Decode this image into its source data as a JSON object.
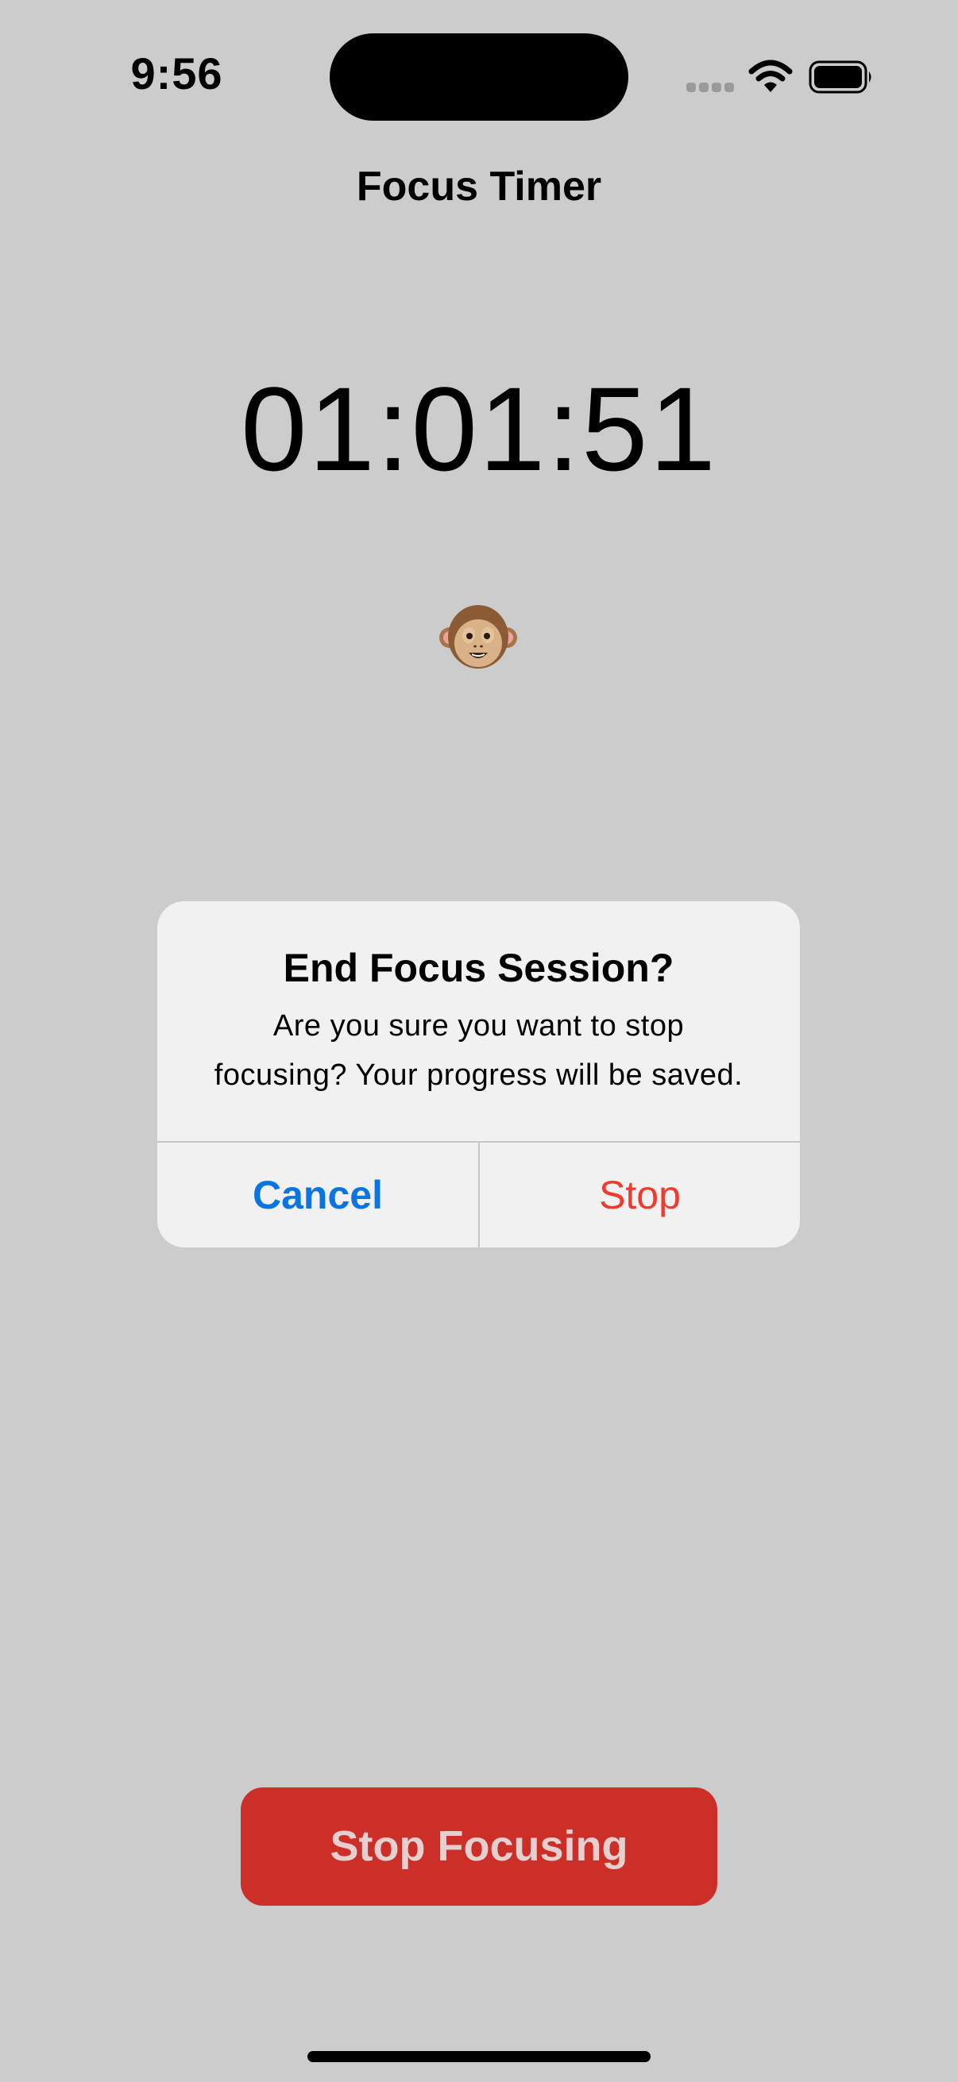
{
  "status_bar": {
    "time": "9:56",
    "icons": [
      "cell-signal-icon",
      "wifi-icon",
      "battery-icon"
    ]
  },
  "nav": {
    "title": "Focus Timer"
  },
  "timer": {
    "display": "01:01:51"
  },
  "mascot": {
    "icon": "monkey-icon"
  },
  "alert": {
    "title": "End Focus Session?",
    "message_line1": "Are you sure you want to stop",
    "message_line2": "focusing? Your progress will be saved.",
    "cancel_label": "Cancel",
    "stop_label": "Stop"
  },
  "primary_action": {
    "label": "Stop Focusing"
  },
  "colors": {
    "background": "#cccccc",
    "alert_background": "#f1f1f1",
    "cancel_blue": "#0a74e0",
    "destructive_red": "#ee3b30",
    "stop_focusing_button": "#cc2e28"
  }
}
